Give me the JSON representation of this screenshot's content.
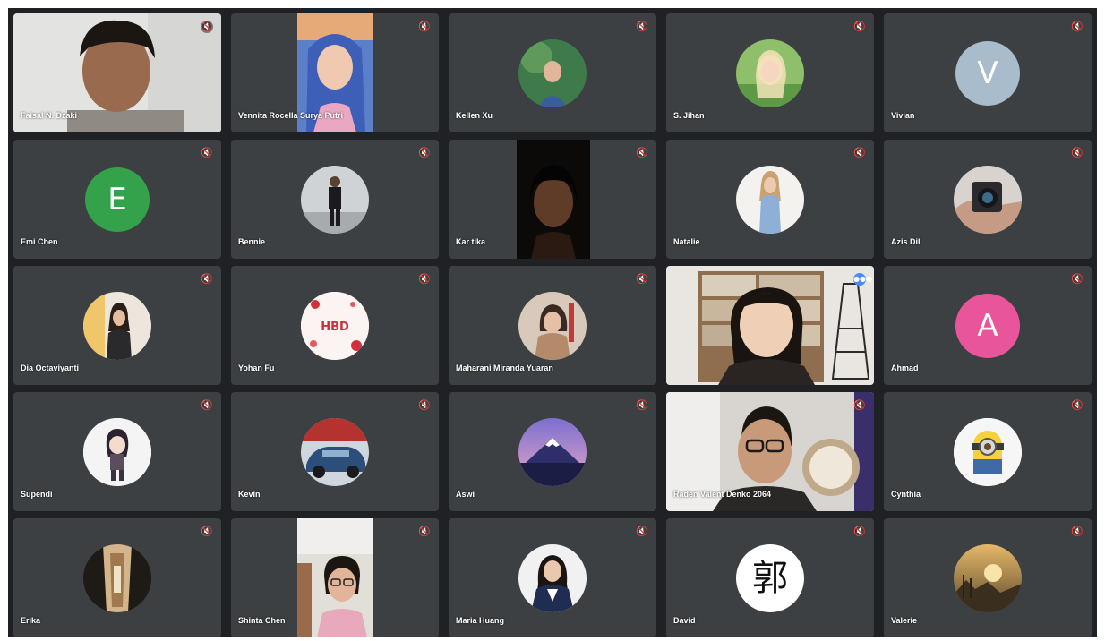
{
  "participants": [
    {
      "name": "Faisal N. Dzaki",
      "mode": "video"
    },
    {
      "name": "Vennita Rocella Surya Putri",
      "mode": "video"
    },
    {
      "name": "Kellen Xu",
      "mode": "avatar"
    },
    {
      "name": "S. Jihan",
      "mode": "avatar"
    },
    {
      "name": "Vivian",
      "mode": "letter",
      "initial": "V",
      "color": "#a8bccb"
    },
    {
      "name": "Emi Chen",
      "mode": "letter",
      "initial": "E",
      "color": "#33a24a"
    },
    {
      "name": "Bennie",
      "mode": "avatar"
    },
    {
      "name": "Kar tika",
      "mode": "video"
    },
    {
      "name": "Natalie",
      "mode": "avatar"
    },
    {
      "name": "Azis Dil",
      "mode": "avatar"
    },
    {
      "name": "Dia Octaviyanti",
      "mode": "avatar"
    },
    {
      "name": "Yohan Fu",
      "mode": "avatar",
      "avatar_text": "HBD"
    },
    {
      "name": "Maharani Miranda Yuaran",
      "mode": "avatar"
    },
    {
      "name": "",
      "mode": "video",
      "active_speaker": true
    },
    {
      "name": "Ahmad",
      "mode": "letter",
      "initial": "A",
      "color": "#e9559a"
    },
    {
      "name": "Supendi",
      "mode": "avatar"
    },
    {
      "name": "Kevin",
      "mode": "avatar"
    },
    {
      "name": "Aswi",
      "mode": "avatar"
    },
    {
      "name": "Raden Valent Denko 2064",
      "mode": "video"
    },
    {
      "name": "Cynthia",
      "mode": "avatar"
    },
    {
      "name": "Erika",
      "mode": "avatar"
    },
    {
      "name": "Shinta Chen",
      "mode": "video"
    },
    {
      "name": "Maria Huang",
      "mode": "avatar"
    },
    {
      "name": "David",
      "mode": "avatar",
      "avatar_text": "郭"
    },
    {
      "name": "Valerie",
      "mode": "avatar"
    }
  ],
  "icons": {
    "mic_off": "mic-off-icon",
    "speaking": "audio-level-icon"
  },
  "colors": {
    "background": "#202124",
    "tile": "#3c4043",
    "active_border": "#4a8af4"
  }
}
